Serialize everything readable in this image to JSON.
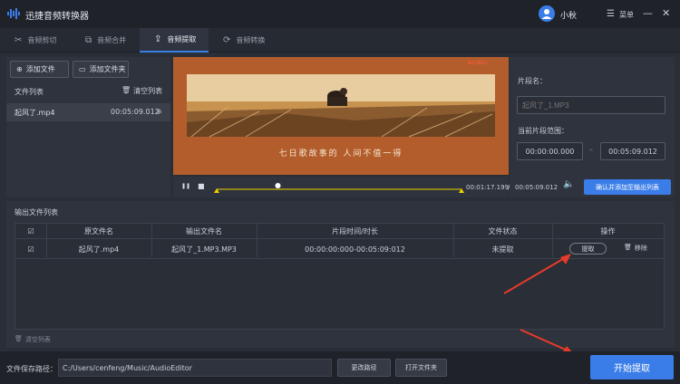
{
  "app": {
    "title": "迅捷音频转换器",
    "user_name": "小秋",
    "menu_label": "菜单"
  },
  "icons": {
    "logo": "audio-wave-icon",
    "menu": "hamburger-menu-icon",
    "minimize": "minimize-icon",
    "close": "close-icon"
  },
  "colors": {
    "accent": "#3b7de8",
    "progress": "#f2d100",
    "arrow": "#e83a2a"
  },
  "tabs": [
    {
      "label": "音频剪切",
      "icon": "scissors-icon",
      "active": false
    },
    {
      "label": "音频合并",
      "icon": "merge-icon",
      "active": false
    },
    {
      "label": "音频提取",
      "icon": "extract-icon",
      "active": true
    },
    {
      "label": "音频转换",
      "icon": "convert-icon",
      "active": false
    }
  ],
  "left": {
    "add_file": "添加文件",
    "add_folder": "添加文件夹",
    "file_list_label": "文件列表",
    "clear_list": "清空列表",
    "file": {
      "name": "起风了.mp4",
      "duration": "00:05:09.012"
    }
  },
  "video": {
    "caption": "七日歌故事的 人间不值一得",
    "watermark": "BILIBILI"
  },
  "clip": {
    "name_label": "片段名：",
    "name_placeholder": "起风了_1.MP3",
    "range_label": "当前片段范围：",
    "start": "00:00:00.000",
    "end": "00:05:09.012",
    "dash": "–"
  },
  "player": {
    "pause": "❚❚",
    "stop": "■",
    "current": "00:01:17.199",
    "separator": "/",
    "total": "00:05:09.012",
    "progress": 0.25,
    "confirm": "确认并添加至输出列表"
  },
  "output": {
    "title": "输出文件列表",
    "headers": [
      "原文件名",
      "输出文件名",
      "片段时间/时长",
      "文件状态",
      "操作"
    ],
    "row": {
      "source": "起风了.mp4",
      "output": "起风了_1.MP3.MP3",
      "time": "00:00:00:000-00:05:09:012",
      "status": "未提取",
      "extract": "提取",
      "remove": "移除"
    },
    "clear": "清空列表"
  },
  "footer": {
    "save_path_label": "文件保存路径：",
    "save_path": "C:/Users/cenfeng/Music/AudioEditor",
    "change_path": "更改路径",
    "open_folder": "打开文件夹",
    "start": "开始提取"
  }
}
